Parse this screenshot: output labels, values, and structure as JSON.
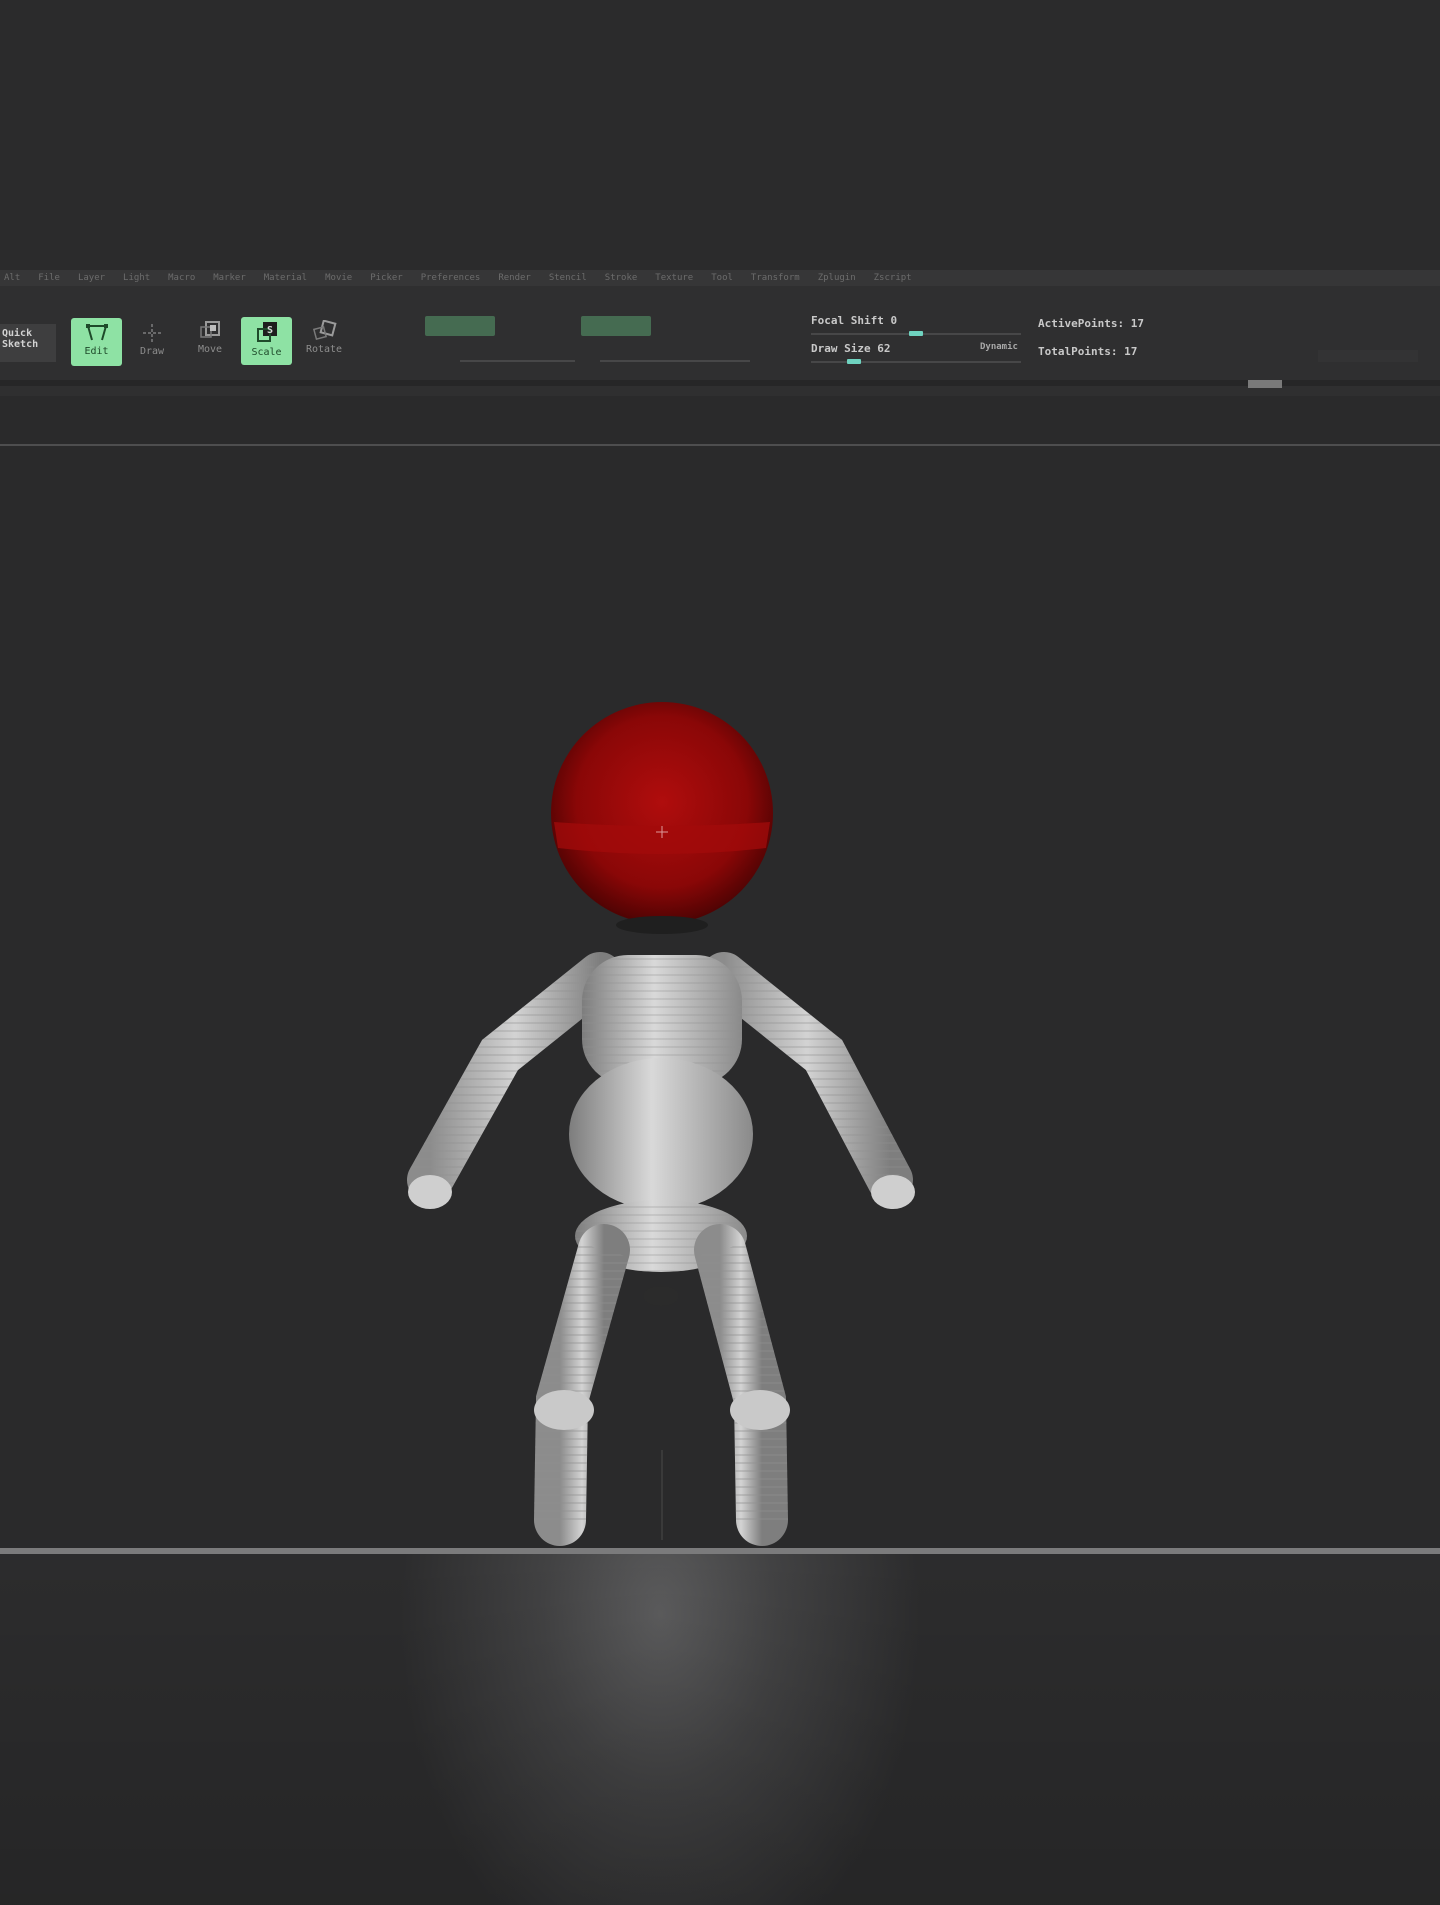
{
  "menu": {
    "items": [
      "Alt",
      "File",
      "Layer",
      "Light",
      "Macro",
      "Marker",
      "Material",
      "Movie",
      "Picker",
      "Preferences",
      "Render",
      "Stencil",
      "Stroke",
      "Texture",
      "Tool",
      "Transform",
      "Zplugin",
      "Zscript"
    ]
  },
  "toolbar": {
    "quick_sketch_label": "Quick\nSketch",
    "edit_label": "Edit",
    "draw_label": "Draw",
    "move_label": "Move",
    "scale_label": "Scale",
    "rotate_label": "Rotate",
    "focal_shift_label": "Focal Shift 0",
    "draw_size_label": "Draw Size 62",
    "dynamic_label": "Dynamic",
    "active_points_label": "ActivePoints: 17",
    "total_points_label": "TotalPoints: 17",
    "focal_shift_value": 0,
    "draw_size_value": 62,
    "accent_color": "#8ee2a4"
  },
  "viewport": {
    "head_color": "#9c0a0a",
    "body_color": "#bdbdbd",
    "background_color": "#2a2a2b"
  }
}
